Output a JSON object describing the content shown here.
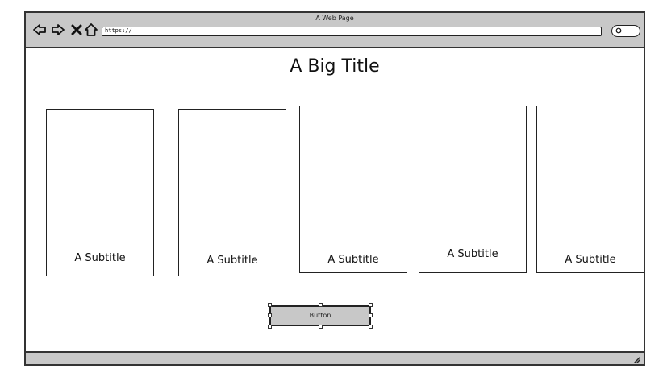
{
  "browser": {
    "window_title": "A Web Page",
    "url": "https://",
    "search_value": ""
  },
  "page": {
    "title": "A Big Title"
  },
  "cards": [
    {
      "subtitle": "A Subtitle"
    },
    {
      "subtitle": "A Subtitle"
    },
    {
      "subtitle": "A Subtitle"
    },
    {
      "subtitle": "A Subtitle"
    },
    {
      "subtitle": "A Subtitle"
    }
  ],
  "button": {
    "label": "Button"
  },
  "colors": {
    "chrome": "#c8c8c8",
    "stroke": "#222222",
    "background": "#ffffff"
  },
  "icons": [
    "back-arrow-icon",
    "forward-arrow-icon",
    "close-icon",
    "home-icon",
    "search-icon",
    "resize-grip-icon"
  ]
}
